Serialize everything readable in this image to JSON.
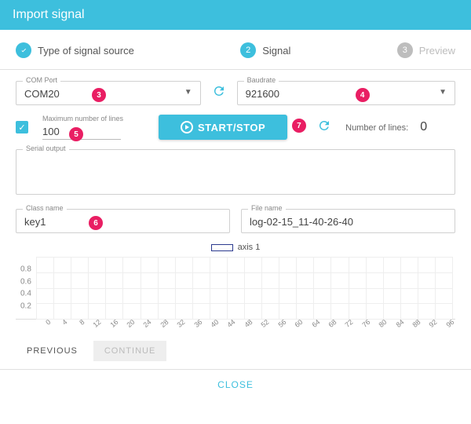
{
  "header": {
    "title": "Import signal"
  },
  "stepper": {
    "steps": [
      {
        "label": "Type of signal source",
        "state": "done"
      },
      {
        "label": "Signal",
        "state": "active",
        "num": "2"
      },
      {
        "label": "Preview",
        "state": "pending",
        "num": "3"
      }
    ]
  },
  "comport": {
    "label": "COM Port",
    "value": "COM20"
  },
  "baudrate": {
    "label": "Baudrate",
    "value": "921600"
  },
  "maxlines": {
    "label": "Maximum number of lines",
    "value": "100"
  },
  "startstop": {
    "label": "START/STOP"
  },
  "numlines": {
    "label": "Number of lines:",
    "value": "0"
  },
  "serialout": {
    "label": "Serial output"
  },
  "classname": {
    "label": "Class name",
    "value": "key1"
  },
  "filename": {
    "label": "File name",
    "value": "log-02-15_11-40-26-40"
  },
  "badges": {
    "b3": "3",
    "b4": "4",
    "b5": "5",
    "b6": "6",
    "b7": "7"
  },
  "chart_data": {
    "type": "line",
    "title": "",
    "legend": [
      "axis 1"
    ],
    "x": [
      0,
      4,
      8,
      12,
      16,
      20,
      24,
      28,
      32,
      36,
      40,
      44,
      48,
      52,
      56,
      60,
      64,
      68,
      72,
      76,
      80,
      84,
      88,
      92,
      96
    ],
    "yticks": [
      0.8,
      0.6,
      0.4,
      0.2
    ],
    "series": [
      {
        "name": "axis 1",
        "values": []
      }
    ],
    "xlim": [
      0,
      96
    ],
    "ylim": [
      0,
      1
    ]
  },
  "nav": {
    "previous": "PREVIOUS",
    "continue": "CONTINUE"
  },
  "close": "CLOSE"
}
